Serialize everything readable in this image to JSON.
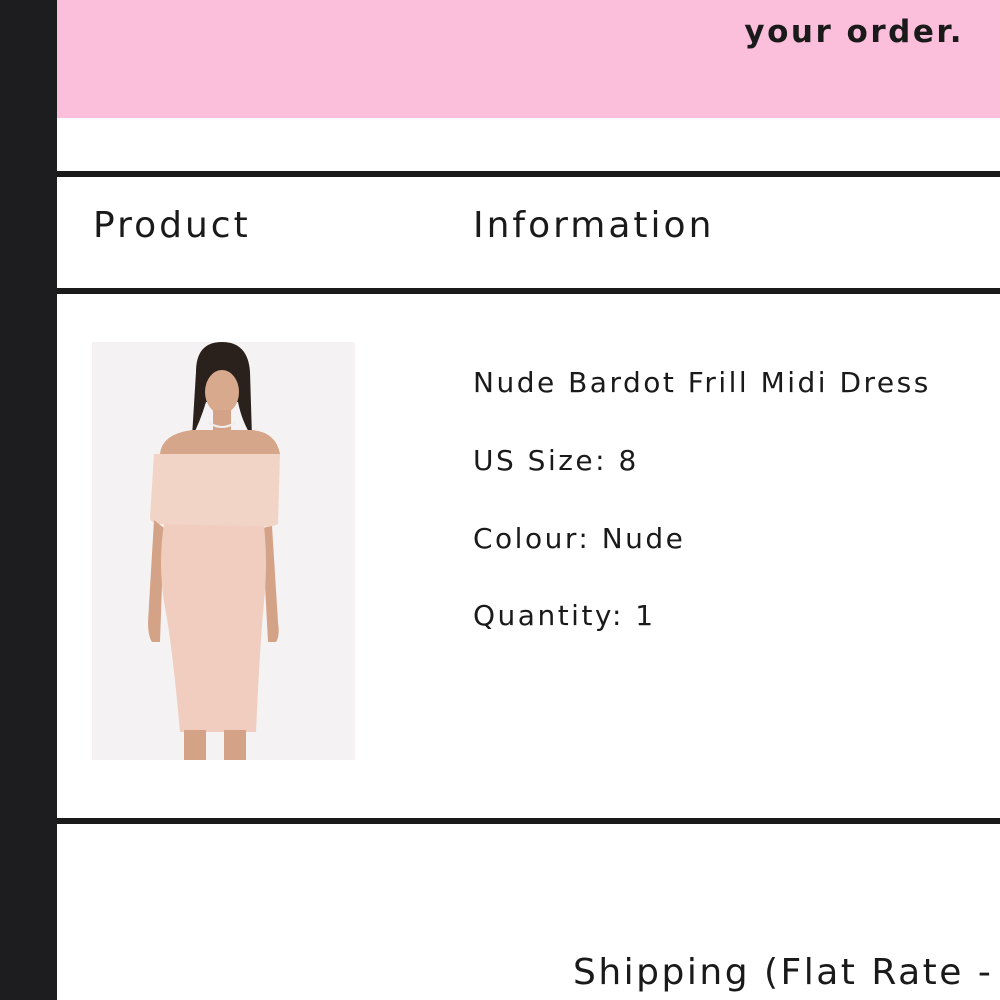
{
  "banner": {
    "text": "your order.",
    "color": "#fbbedb"
  },
  "table": {
    "headers": [
      "Product",
      "Information"
    ]
  },
  "order_item": {
    "image_alt": "Nude Bardot Frill Midi Dress product photo",
    "name": "Nude Bardot Frill Midi Dress",
    "size_line": "US Size: 8",
    "colour_line": "Colour: Nude",
    "quantity_line": "Quantity: 1"
  },
  "shipping": {
    "label": "Shipping (Flat Rate -"
  },
  "colors": {
    "sidebar": "#1d1d1f",
    "rule": "#1a1a1a",
    "text": "#1a1a1a"
  }
}
